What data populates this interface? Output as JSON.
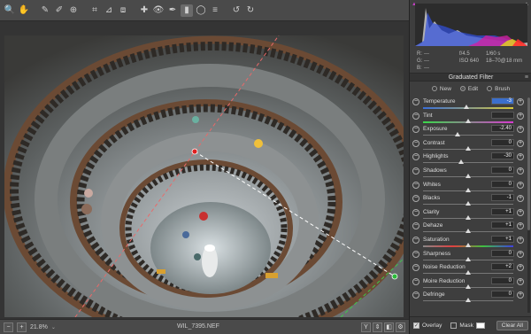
{
  "toolbar": {
    "tools": [
      {
        "name": "zoom-icon",
        "glyph": "🔍"
      },
      {
        "name": "hand-icon",
        "glyph": "✋"
      },
      {
        "name": "white-balance-icon",
        "glyph": "✎"
      },
      {
        "name": "color-sampler-icon",
        "glyph": "✐"
      },
      {
        "name": "target-adjust-icon",
        "glyph": "⊕"
      },
      {
        "name": "crop-icon",
        "glyph": "⌗"
      },
      {
        "name": "straighten-icon",
        "glyph": "⊿"
      },
      {
        "name": "transform-icon",
        "glyph": "⧈"
      },
      {
        "name": "spot-removal-icon",
        "glyph": "✚"
      },
      {
        "name": "red-eye-icon",
        "glyph": "👁"
      },
      {
        "name": "adjustment-brush-icon",
        "glyph": "✒"
      },
      {
        "name": "graduated-filter-icon",
        "glyph": "▮"
      },
      {
        "name": "radial-filter-icon",
        "glyph": "◯"
      },
      {
        "name": "preferences-icon",
        "glyph": "≡"
      },
      {
        "name": "rotate-left-icon",
        "glyph": "↺"
      },
      {
        "name": "rotate-right-icon",
        "glyph": "↻"
      }
    ]
  },
  "bottom": {
    "zoom": "21.8%",
    "filename": "WIL_7395.NEF",
    "view_buttons": [
      "Y",
      "⇕",
      "◧",
      "⚙"
    ]
  },
  "readout": {
    "r": "R:",
    "r_val": "---",
    "g": "G:",
    "g_val": "---",
    "b": "B:",
    "b_val": "---",
    "aperture": "f/4.5",
    "shutter": "1/60 s",
    "iso": "ISO 640",
    "lens": "18–70@18 mm"
  },
  "panel": {
    "title": "Graduated Filter",
    "modes": [
      {
        "label": "New",
        "selected": false
      },
      {
        "label": "Edit",
        "selected": true
      },
      {
        "label": "Brush",
        "selected": false
      }
    ],
    "sliders": [
      {
        "label": "Temperature",
        "value": "-3",
        "selected": true,
        "pos": 0.48
      },
      {
        "label": "Tint",
        "value": "",
        "selected": false,
        "pos": 0.5
      },
      {
        "label": "Exposure",
        "value": "-2.40",
        "selected": false,
        "pos": 0.38
      },
      {
        "label": "Contrast",
        "value": "0",
        "selected": false,
        "pos": 0.5
      },
      {
        "label": "Highlights",
        "value": "-30",
        "selected": false,
        "pos": 0.42
      },
      {
        "label": "Shadows",
        "value": "0",
        "selected": false,
        "pos": 0.5
      },
      {
        "label": "Whites",
        "value": "0",
        "selected": false,
        "pos": 0.5
      },
      {
        "label": "Blacks",
        "value": "-1",
        "selected": false,
        "pos": 0.5
      },
      {
        "label": "Clarity",
        "value": "+1",
        "selected": false,
        "pos": 0.5
      },
      {
        "label": "Dehaze",
        "value": "+1",
        "selected": false,
        "pos": 0.5
      },
      {
        "label": "Saturation",
        "value": "+1",
        "selected": false,
        "pos": 0.5
      },
      {
        "label": "Sharpness",
        "value": "0",
        "selected": false,
        "pos": 0.5
      },
      {
        "label": "Noise Reduction",
        "value": "+2",
        "selected": false,
        "pos": 0.5
      },
      {
        "label": "Moire Reduction",
        "value": "0",
        "selected": false,
        "pos": 0.5
      },
      {
        "label": "Defringe",
        "value": "0",
        "selected": false,
        "pos": 0.5
      }
    ]
  },
  "footer": {
    "overlay": "Overlay",
    "overlay_checked": true,
    "mask": "Mask",
    "mask_checked": false,
    "clear_all": "Clear All"
  }
}
